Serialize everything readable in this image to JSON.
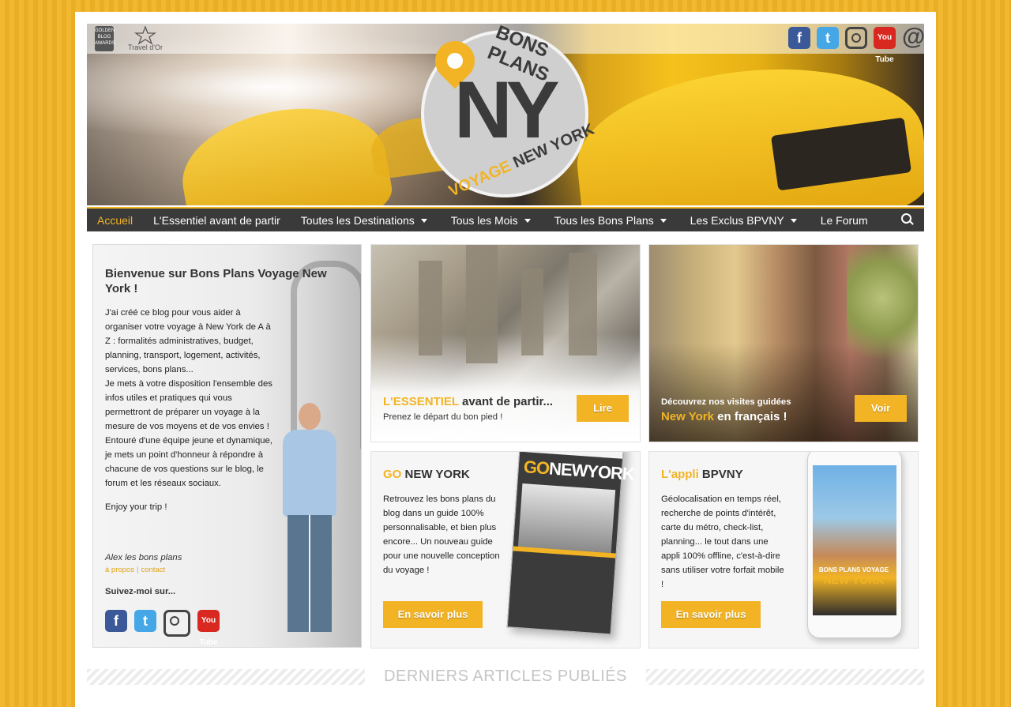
{
  "header": {
    "award1": "GOLDEN BLOG AWARDS",
    "award2": "Travel d'Or",
    "logo": {
      "top": "BONS PLANS",
      "center": "NY",
      "bottom_a": "VOYAGE",
      "bottom_b": "NEW YORK"
    },
    "social_icons": [
      "facebook-icon",
      "twitter-icon",
      "instagram-icon",
      "youtube-icon",
      "email-icon"
    ],
    "social_glyphs": {
      "facebook": "f",
      "twitter": "t",
      "youtube": "You Tube",
      "email": "@"
    }
  },
  "nav": {
    "items": [
      {
        "label": "Accueil",
        "active": true,
        "dropdown": false
      },
      {
        "label": "L'Essentiel avant de partir",
        "active": false,
        "dropdown": false
      },
      {
        "label": "Toutes les Destinations",
        "active": false,
        "dropdown": true
      },
      {
        "label": "Tous les Mois",
        "active": false,
        "dropdown": true
      },
      {
        "label": "Tous les Bons Plans",
        "active": false,
        "dropdown": true
      },
      {
        "label": "Les Exclus BPVNY",
        "active": false,
        "dropdown": true
      },
      {
        "label": "Le Forum",
        "active": false,
        "dropdown": false
      }
    ]
  },
  "welcome": {
    "title": "Bienvenue sur Bons Plans Voyage New York !",
    "p1": "J'ai créé ce blog pour vous aider à organiser votre voyage à New York de A à Z : formalités administratives, budget, planning, transport, logement, activités, services, bons plans...",
    "p2": "Je mets à votre disposition l'ensemble des infos utiles et pratiques qui vous permettront de préparer un voyage à la mesure de vos moyens et de vos envies !",
    "p3": "Entouré d'une équipe jeune et dynamique, je mets un point d'honneur à répondre à chacune de vos questions sur le blog, le forum et les réseaux sociaux.",
    "p4": "Enjoy your trip !",
    "signature": "Alex les bons plans",
    "link_about": "à propos",
    "link_sep": "|",
    "link_contact": "contact",
    "follow": "Suivez-moi sur..."
  },
  "cards": {
    "essentiel": {
      "title_y": "L'ESSENTIEL",
      "title_rest": "avant de partir...",
      "subtitle": "Prenez le départ du bon pied !",
      "button": "Lire"
    },
    "visites": {
      "line1": "Découvrez nos visites guidées",
      "title_y": "New York",
      "title_rest": "en français !",
      "button": "Voir"
    },
    "guide": {
      "title_y": "GO",
      "title_rest": "NEW YORK",
      "body": "Retrouvez les bons plans du blog dans un guide 100% personnalisable, et bien plus encore... Un nouveau guide pour une nouvelle conception du voyage !",
      "button": "En savoir plus",
      "book_title_y": "GO",
      "book_title_rest": "NEWYORK"
    },
    "appli": {
      "title_y": "L'appli",
      "title_rest": "BPVNY",
      "body": "Géolocalisation en temps réel, recherche de points d'intérêt, carte du métro, check-list, planning... le tout dans une appli 100% offline, c'est-à-dire sans utiliser votre forfait mobile !",
      "button": "En savoir plus",
      "phone_small": "BONS PLANS VOYAGE",
      "phone_big": "NEW YORK"
    }
  },
  "latest": {
    "title": "DERNIERS ARTICLES PUBLIÉS"
  },
  "colors": {
    "accent": "#f2b425",
    "nav_bg": "#3a3a3a",
    "text": "#333333"
  }
}
